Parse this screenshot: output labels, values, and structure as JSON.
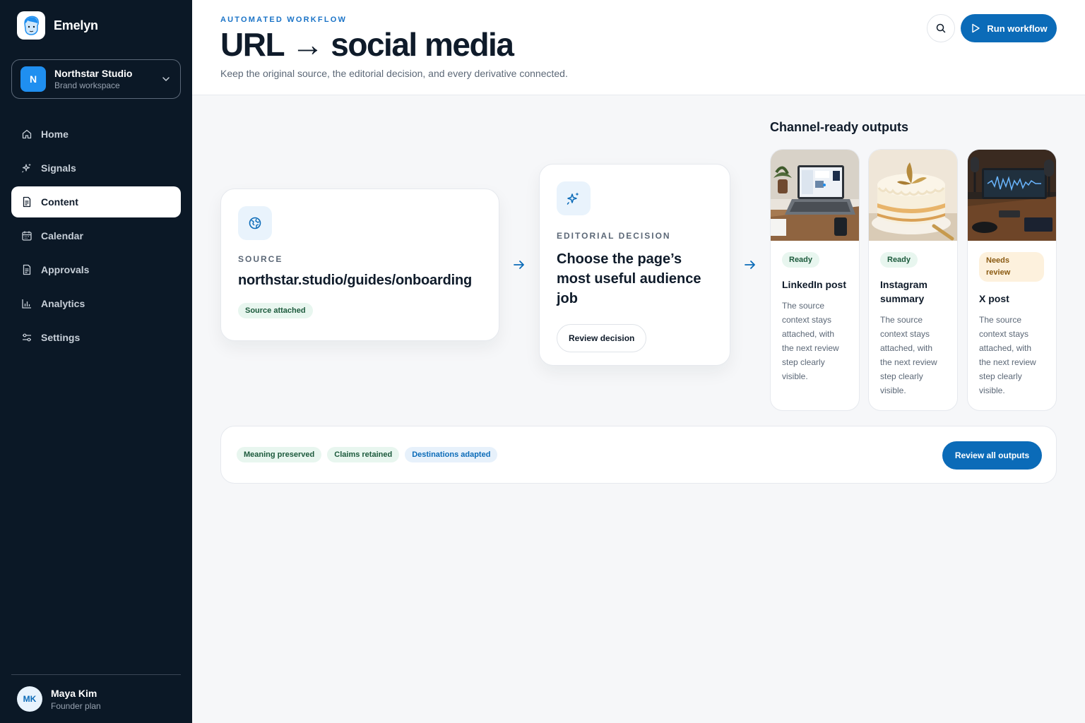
{
  "app": {
    "name": "Emelyn"
  },
  "workspace": {
    "initial": "N",
    "name": "Northstar Studio",
    "type": "Brand workspace"
  },
  "nav": {
    "items": [
      {
        "label": "Home",
        "icon": "home-icon"
      },
      {
        "label": "Signals",
        "icon": "sparkle-icon"
      },
      {
        "label": "Content",
        "icon": "document-icon",
        "active": true
      },
      {
        "label": "Calendar",
        "icon": "calendar-icon"
      },
      {
        "label": "Approvals",
        "icon": "document-check-icon"
      },
      {
        "label": "Analytics",
        "icon": "bar-chart-icon"
      },
      {
        "label": "Settings",
        "icon": "sliders-icon"
      }
    ]
  },
  "user": {
    "initials": "MK",
    "name": "Maya Kim",
    "plan": "Founder plan"
  },
  "header": {
    "eyebrow": "AUTOMATED WORKFLOW",
    "title": "URL → social media",
    "subtitle": "Keep the original source, the editorial decision, and every derivative connected.",
    "run_label": "Run workflow"
  },
  "source": {
    "eyebrow": "SOURCE",
    "url": "northstar.studio/guides/onboarding",
    "badge": "Source attached"
  },
  "decision": {
    "eyebrow": "EDITORIAL DECISION",
    "title": "Choose the page’s most useful audience job",
    "button": "Review decision"
  },
  "outputs": {
    "title": "Channel-ready outputs",
    "items": [
      {
        "status": "Ready",
        "name": "LinkedIn post",
        "desc": "The source context stays attached, with the next review step clearly visible.",
        "image": "laptop-workspace"
      },
      {
        "status": "Ready",
        "name": "Instagram summary",
        "desc": "The source context stays attached, with the next review step clearly visible.",
        "image": "cake"
      },
      {
        "status": "Needs review",
        "name": "X post",
        "desc": "The source context stays attached, with the next review step clearly visible.",
        "image": "podcast-studio"
      }
    ]
  },
  "summary": {
    "pills": [
      "Meaning preserved",
      "Claims retained",
      "Destinations adapted"
    ],
    "button": "Review all outputs"
  },
  "colors": {
    "sidebar": "#0b1826",
    "accent": "#0b6bb8",
    "ready_bg": "#e8f6ef",
    "review_bg": "#fdf1dd"
  }
}
